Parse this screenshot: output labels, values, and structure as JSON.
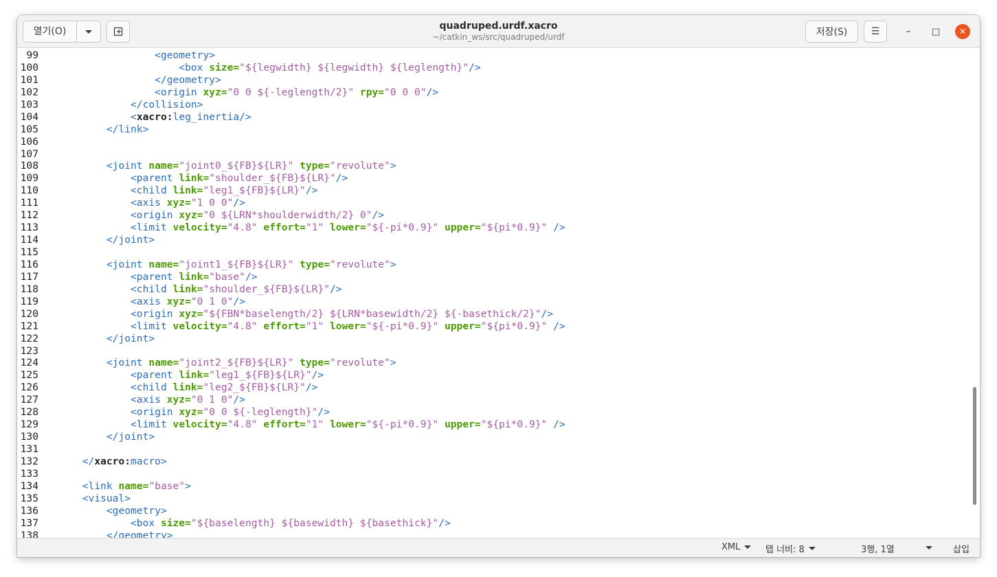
{
  "header": {
    "open_label": "열기(O)",
    "title": "quadruped.urdf.xacro",
    "subtitle": "~/catkin_ws/src/quadruped/urdf",
    "save_label": "저장(S)",
    "menu_icon": "☰",
    "minimize_icon": "–",
    "maximize_icon": "□",
    "close_icon": "✕"
  },
  "editor": {
    "lines": [
      {
        "n": "99",
        "segs": [
          [
            "s",
            "                  "
          ],
          [
            "t",
            "<geometry>"
          ]
        ]
      },
      {
        "n": "100",
        "segs": [
          [
            "s",
            "                      "
          ],
          [
            "t",
            "<box "
          ],
          [
            "a",
            "size="
          ],
          [
            "v",
            "\"${legwidth} ${legwidth} ${leglength}\""
          ],
          [
            "t",
            "/>"
          ]
        ]
      },
      {
        "n": "101",
        "segs": [
          [
            "s",
            "                  "
          ],
          [
            "t",
            "</geometry>"
          ]
        ]
      },
      {
        "n": "102",
        "segs": [
          [
            "s",
            "                  "
          ],
          [
            "t",
            "<origin "
          ],
          [
            "a",
            "xyz="
          ],
          [
            "v",
            "\"0 0 ${-leglength/2}\""
          ],
          [
            "s",
            " "
          ],
          [
            "a",
            "rpy="
          ],
          [
            "v",
            "\"0 0 0\""
          ],
          [
            "t",
            "/>"
          ]
        ]
      },
      {
        "n": "103",
        "segs": [
          [
            "s",
            "              "
          ],
          [
            "t",
            "</collision>"
          ]
        ]
      },
      {
        "n": "104",
        "segs": [
          [
            "s",
            "              "
          ],
          [
            "t",
            "<"
          ],
          [
            "n",
            "xacro:"
          ],
          [
            "t",
            "leg_inertia/>"
          ]
        ]
      },
      {
        "n": "105",
        "segs": [
          [
            "s",
            "          "
          ],
          [
            "t",
            "</link>"
          ]
        ]
      },
      {
        "n": "106",
        "segs": []
      },
      {
        "n": "107",
        "segs": []
      },
      {
        "n": "108",
        "segs": [
          [
            "s",
            "          "
          ],
          [
            "t",
            "<joint "
          ],
          [
            "a",
            "name="
          ],
          [
            "v",
            "\"joint0_${FB}${LR}\""
          ],
          [
            "s",
            " "
          ],
          [
            "a",
            "type="
          ],
          [
            "v",
            "\"revolute\""
          ],
          [
            "t",
            ">"
          ]
        ]
      },
      {
        "n": "109",
        "segs": [
          [
            "s",
            "              "
          ],
          [
            "t",
            "<parent "
          ],
          [
            "a",
            "link="
          ],
          [
            "v",
            "\"shoulder_${FB}${LR}\""
          ],
          [
            "t",
            "/>"
          ]
        ]
      },
      {
        "n": "110",
        "segs": [
          [
            "s",
            "              "
          ],
          [
            "t",
            "<child "
          ],
          [
            "a",
            "link="
          ],
          [
            "v",
            "\"leg1_${FB}${LR}\""
          ],
          [
            "t",
            "/>"
          ]
        ]
      },
      {
        "n": "111",
        "segs": [
          [
            "s",
            "              "
          ],
          [
            "t",
            "<axis "
          ],
          [
            "a",
            "xyz="
          ],
          [
            "v",
            "\"1 0 0\""
          ],
          [
            "t",
            "/>"
          ]
        ]
      },
      {
        "n": "112",
        "segs": [
          [
            "s",
            "              "
          ],
          [
            "t",
            "<origin "
          ],
          [
            "a",
            "xyz="
          ],
          [
            "v",
            "\"0 ${LRN*shoulderwidth/2} 0\""
          ],
          [
            "t",
            "/>"
          ]
        ]
      },
      {
        "n": "113",
        "segs": [
          [
            "s",
            "              "
          ],
          [
            "t",
            "<limit "
          ],
          [
            "a",
            "velocity="
          ],
          [
            "v",
            "\"4.8\""
          ],
          [
            "s",
            " "
          ],
          [
            "a",
            "effort="
          ],
          [
            "v",
            "\"1\""
          ],
          [
            "s",
            " "
          ],
          [
            "a",
            "lower="
          ],
          [
            "v",
            "\"${-pi*0.9}\""
          ],
          [
            "s",
            " "
          ],
          [
            "a",
            "upper="
          ],
          [
            "v",
            "\"${pi*0.9}\""
          ],
          [
            "s",
            " "
          ],
          [
            "t",
            "/>"
          ]
        ]
      },
      {
        "n": "114",
        "segs": [
          [
            "s",
            "          "
          ],
          [
            "t",
            "</joint>"
          ]
        ]
      },
      {
        "n": "115",
        "segs": []
      },
      {
        "n": "116",
        "segs": [
          [
            "s",
            "          "
          ],
          [
            "t",
            "<joint "
          ],
          [
            "a",
            "name="
          ],
          [
            "v",
            "\"joint1_${FB}${LR}\""
          ],
          [
            "s",
            " "
          ],
          [
            "a",
            "type="
          ],
          [
            "v",
            "\"revolute\""
          ],
          [
            "t",
            ">"
          ]
        ]
      },
      {
        "n": "117",
        "segs": [
          [
            "s",
            "              "
          ],
          [
            "t",
            "<parent "
          ],
          [
            "a",
            "link="
          ],
          [
            "v",
            "\"base\""
          ],
          [
            "t",
            "/>"
          ]
        ]
      },
      {
        "n": "118",
        "segs": [
          [
            "s",
            "              "
          ],
          [
            "t",
            "<child "
          ],
          [
            "a",
            "link="
          ],
          [
            "v",
            "\"shoulder_${FB}${LR}\""
          ],
          [
            "t",
            "/>"
          ]
        ]
      },
      {
        "n": "119",
        "segs": [
          [
            "s",
            "              "
          ],
          [
            "t",
            "<axis "
          ],
          [
            "a",
            "xyz="
          ],
          [
            "v",
            "\"0 1 0\""
          ],
          [
            "t",
            "/>"
          ]
        ]
      },
      {
        "n": "120",
        "segs": [
          [
            "s",
            "              "
          ],
          [
            "t",
            "<origin "
          ],
          [
            "a",
            "xyz="
          ],
          [
            "v",
            "\"${FBN*baselength/2} ${LRN*basewidth/2} ${-basethick/2}\""
          ],
          [
            "t",
            "/>"
          ]
        ]
      },
      {
        "n": "121",
        "segs": [
          [
            "s",
            "              "
          ],
          [
            "t",
            "<limit "
          ],
          [
            "a",
            "velocity="
          ],
          [
            "v",
            "\"4.8\""
          ],
          [
            "s",
            " "
          ],
          [
            "a",
            "effort="
          ],
          [
            "v",
            "\"1\""
          ],
          [
            "s",
            " "
          ],
          [
            "a",
            "lower="
          ],
          [
            "v",
            "\"${-pi*0.9}\""
          ],
          [
            "s",
            " "
          ],
          [
            "a",
            "upper="
          ],
          [
            "v",
            "\"${pi*0.9}\""
          ],
          [
            "s",
            " "
          ],
          [
            "t",
            "/>"
          ]
        ]
      },
      {
        "n": "122",
        "segs": [
          [
            "s",
            "          "
          ],
          [
            "t",
            "</joint>"
          ]
        ]
      },
      {
        "n": "123",
        "segs": []
      },
      {
        "n": "124",
        "segs": [
          [
            "s",
            "          "
          ],
          [
            "t",
            "<joint "
          ],
          [
            "a",
            "name="
          ],
          [
            "v",
            "\"joint2_${FB}${LR}\""
          ],
          [
            "s",
            " "
          ],
          [
            "a",
            "type="
          ],
          [
            "v",
            "\"revolute\""
          ],
          [
            "t",
            ">"
          ]
        ]
      },
      {
        "n": "125",
        "segs": [
          [
            "s",
            "              "
          ],
          [
            "t",
            "<parent "
          ],
          [
            "a",
            "link="
          ],
          [
            "v",
            "\"leg1_${FB}${LR}\""
          ],
          [
            "t",
            "/>"
          ]
        ]
      },
      {
        "n": "126",
        "segs": [
          [
            "s",
            "              "
          ],
          [
            "t",
            "<child "
          ],
          [
            "a",
            "link="
          ],
          [
            "v",
            "\"leg2_${FB}${LR}\""
          ],
          [
            "t",
            "/>"
          ]
        ]
      },
      {
        "n": "127",
        "segs": [
          [
            "s",
            "              "
          ],
          [
            "t",
            "<axis "
          ],
          [
            "a",
            "xyz="
          ],
          [
            "v",
            "\"0 1 0\""
          ],
          [
            "t",
            "/>"
          ]
        ]
      },
      {
        "n": "128",
        "segs": [
          [
            "s",
            "              "
          ],
          [
            "t",
            "<origin "
          ],
          [
            "a",
            "xyz="
          ],
          [
            "v",
            "\"0 0 ${-leglength}\""
          ],
          [
            "t",
            "/>"
          ]
        ]
      },
      {
        "n": "129",
        "segs": [
          [
            "s",
            "              "
          ],
          [
            "t",
            "<limit "
          ],
          [
            "a",
            "velocity="
          ],
          [
            "v",
            "\"4.8\""
          ],
          [
            "s",
            " "
          ],
          [
            "a",
            "effort="
          ],
          [
            "v",
            "\"1\""
          ],
          [
            "s",
            " "
          ],
          [
            "a",
            "lower="
          ],
          [
            "v",
            "\"${-pi*0.9}\""
          ],
          [
            "s",
            " "
          ],
          [
            "a",
            "upper="
          ],
          [
            "v",
            "\"${pi*0.9}\""
          ],
          [
            "s",
            " "
          ],
          [
            "t",
            "/>"
          ]
        ]
      },
      {
        "n": "130",
        "segs": [
          [
            "s",
            "          "
          ],
          [
            "t",
            "</joint>"
          ]
        ]
      },
      {
        "n": "131",
        "segs": []
      },
      {
        "n": "132",
        "segs": [
          [
            "s",
            "      "
          ],
          [
            "t",
            "</"
          ],
          [
            "n",
            "xacro:"
          ],
          [
            "t",
            "macro>"
          ]
        ]
      },
      {
        "n": "133",
        "segs": []
      },
      {
        "n": "134",
        "segs": [
          [
            "s",
            "      "
          ],
          [
            "t",
            "<link "
          ],
          [
            "a",
            "name="
          ],
          [
            "v",
            "\"base\""
          ],
          [
            "t",
            ">"
          ]
        ]
      },
      {
        "n": "135",
        "segs": [
          [
            "s",
            "      "
          ],
          [
            "t",
            "<visual>"
          ]
        ]
      },
      {
        "n": "136",
        "segs": [
          [
            "s",
            "          "
          ],
          [
            "t",
            "<geometry>"
          ]
        ]
      },
      {
        "n": "137",
        "segs": [
          [
            "s",
            "              "
          ],
          [
            "t",
            "<box "
          ],
          [
            "a",
            "size="
          ],
          [
            "v",
            "\"${baselength} ${basewidth} ${basethick}\""
          ],
          [
            "t",
            "/>"
          ]
        ]
      },
      {
        "n": "138",
        "segs": [
          [
            "s",
            "          "
          ],
          [
            "t",
            "</geometry>"
          ]
        ]
      }
    ]
  },
  "statusbar": {
    "language": "XML",
    "tab_width": "탭 너비: 8",
    "cursor_position": "3행, 1열",
    "insert_mode": "삽입"
  }
}
